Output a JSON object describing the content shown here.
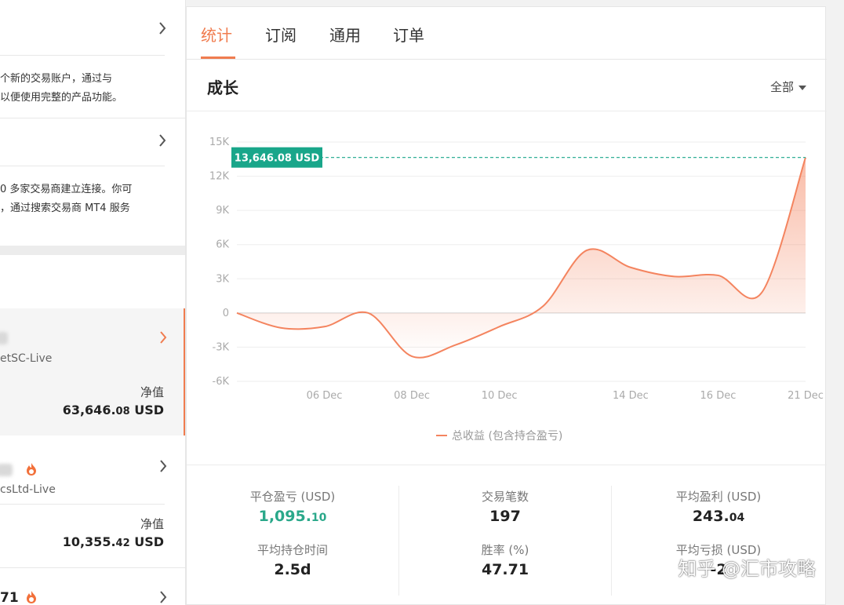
{
  "left_panel": {
    "intro_text": {
      "line1": "个新的交易账户，通过与",
      "line2": "以便使用完整的产品功能。"
    },
    "broker_text": {
      "line1": "0 多家交易商建立连接。你可",
      "line2_link": "",
      "line2_rest": "，通过搜索交易商 MT4 服务"
    },
    "accounts": [
      {
        "server": "etSC-Live",
        "equity_label": "净值",
        "equity_main": "63,646.",
        "equity_small": "08",
        "equity_unit": " USD"
      },
      {
        "server": "csLtd-Live",
        "equity_label": "净值",
        "equity_main": "10,355.",
        "equity_small": "42",
        "equity_unit": " USD"
      },
      {
        "server": "71",
        "equity_label": "",
        "equity_main": "",
        "equity_small": "",
        "equity_unit": ""
      }
    ]
  },
  "tabs": [
    {
      "label": "统计",
      "active": true
    },
    {
      "label": "订阅",
      "active": false
    },
    {
      "label": "通用",
      "active": false
    },
    {
      "label": "订单",
      "active": false
    }
  ],
  "section": {
    "title": "成长",
    "range": "全部"
  },
  "chart_data": {
    "type": "area",
    "x": [
      "04 Dec",
      "05 Dec",
      "06 Dec",
      "07 Dec",
      "08 Dec",
      "09 Dec",
      "10 Dec",
      "11 Dec",
      "13 Dec",
      "14 Dec",
      "15 Dec",
      "16 Dec",
      "17 Dec",
      "21 Dec"
    ],
    "x_ticks": [
      "06 Dec",
      "08 Dec",
      "10 Dec",
      "14 Dec",
      "16 Dec",
      "21 Dec"
    ],
    "y_ticks": [
      "15K",
      "12K",
      "9K",
      "6K",
      "3K",
      "0",
      "-3K",
      "-6K"
    ],
    "ylim": [
      -6000,
      15000
    ],
    "series": [
      {
        "name": "总收益 (包含持合盈亏)",
        "values": [
          0,
          -1300,
          -1200,
          0,
          -3800,
          -2800,
          -1200,
          600,
          5500,
          4000,
          3200,
          3300,
          1800,
          13646.08
        ]
      }
    ],
    "last_value_label": "13,646.08 USD",
    "colors": {
      "line": "#f4845f",
      "marker": "#19a68a",
      "grid": "#eeeeee"
    },
    "grid": true,
    "legend": "bottom"
  },
  "stats": [
    {
      "label": "平仓盈亏 (USD)",
      "value_main": "1,095.",
      "value_small": "10",
      "color": "green"
    },
    {
      "label": "交易笔数",
      "value_main": "197",
      "value_small": "",
      "color": "default"
    },
    {
      "label": "平均盈利 (USD)",
      "value_main": "243.",
      "value_small": "04",
      "color": "default"
    },
    {
      "label": "平均持仓时间",
      "value_main": "2.5d",
      "value_small": "",
      "color": "default"
    },
    {
      "label": "胜率 (%)",
      "value_main": "47.71",
      "value_small": "",
      "color": "default"
    },
    {
      "label": "平均亏损 (USD)",
      "value_main": "-2",
      "value_small": "",
      "color": "default"
    }
  ],
  "watermark": "知乎 @汇市攻略"
}
